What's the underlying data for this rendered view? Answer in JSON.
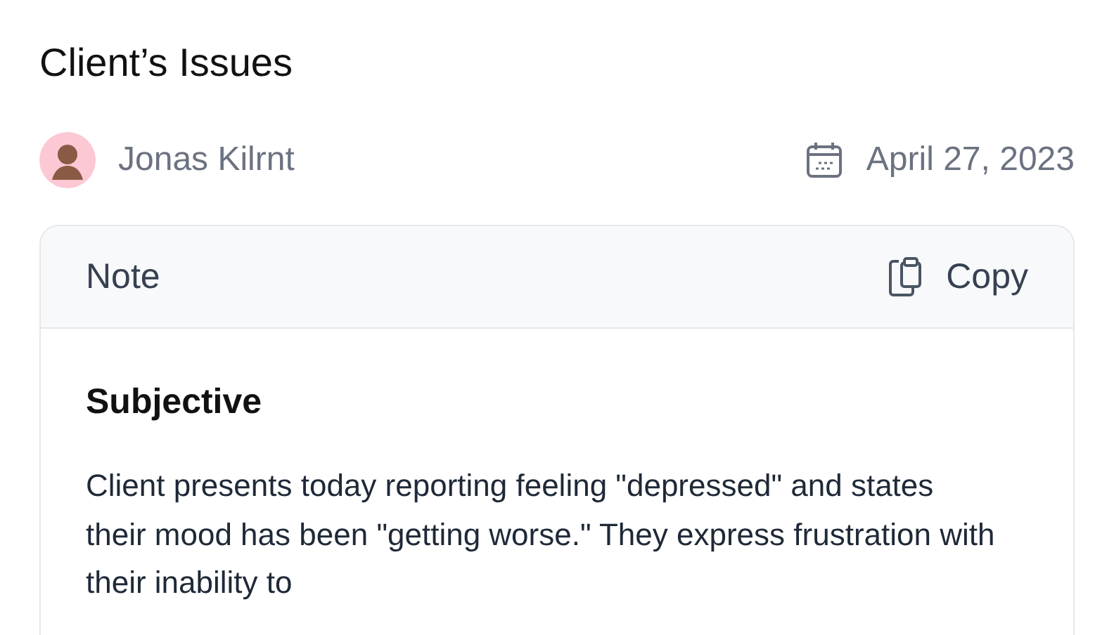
{
  "title": "Client’s Issues",
  "author": {
    "name": "Jonas Kilrnt"
  },
  "date": "April 27, 2023",
  "note": {
    "header": "Note",
    "copy_label": "Copy",
    "section_title": "Subjective",
    "text": "Client presents today reporting feeling \"depressed\" and states their mood has been \"getting worse.\" They express frustration with their inability to"
  }
}
